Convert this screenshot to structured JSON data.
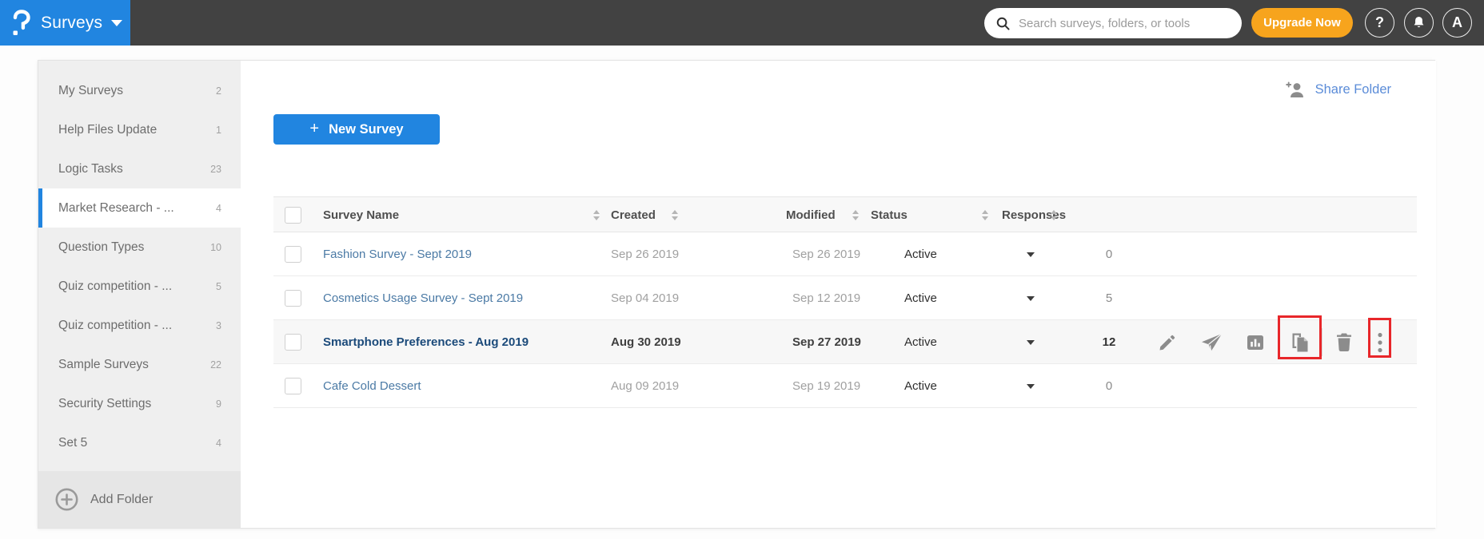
{
  "header": {
    "product_name": "Surveys",
    "search_placeholder": "Search surveys, folders, or tools",
    "upgrade_button": "Upgrade Now",
    "help_glyph": "?",
    "avatar_letter": "A"
  },
  "colors": {
    "topbar": "#424242",
    "brand_blue": "#2185e0",
    "accent_orange": "#f7a41d",
    "annotation_red": "#e8262a",
    "link_blue": "#4b7aa5"
  },
  "sidebar": {
    "items": [
      {
        "label": "My Surveys",
        "count": "2",
        "selected": false
      },
      {
        "label": "Help Files Update",
        "count": "1",
        "selected": false
      },
      {
        "label": "Logic Tasks",
        "count": "23",
        "selected": false
      },
      {
        "label": "Market Research - ...",
        "count": "4",
        "selected": true
      },
      {
        "label": "Question Types",
        "count": "10",
        "selected": false
      },
      {
        "label": "Quiz competition - ...",
        "count": "5",
        "selected": false
      },
      {
        "label": "Quiz competition - ...",
        "count": "3",
        "selected": false
      },
      {
        "label": "Sample Surveys",
        "count": "22",
        "selected": false
      },
      {
        "label": "Security Settings",
        "count": "9",
        "selected": false
      },
      {
        "label": "Set 5",
        "count": "4",
        "selected": false
      }
    ],
    "add_folder_label": "Add Folder"
  },
  "main": {
    "share_folder_label": "Share Folder",
    "new_survey_plus": "+",
    "new_survey_label": "New Survey",
    "table": {
      "columns": [
        "Survey Name",
        "Created",
        "Modified",
        "Status",
        "Responses"
      ],
      "rows": [
        {
          "name": "Fashion Survey - Sept 2019",
          "created": "Sep 26 2019",
          "modified": "Sep 26 2019",
          "status": "Active",
          "responses": "0",
          "highlighted": false
        },
        {
          "name": "Cosmetics Usage Survey - Sept 2019",
          "created": "Sep 04 2019",
          "modified": "Sep 12 2019",
          "status": "Active",
          "responses": "5",
          "highlighted": false
        },
        {
          "name": "Smartphone Preferences - Aug 2019",
          "created": "Aug 30 2019",
          "modified": "Sep 27 2019",
          "status": "Active",
          "responses": "12",
          "highlighted": true
        },
        {
          "name": "Cafe Cold Dessert",
          "created": "Aug 09 2019",
          "modified": "Sep 19 2019",
          "status": "Active",
          "responses": "0",
          "highlighted": false
        }
      ],
      "row_actions": [
        "edit",
        "send",
        "reports",
        "copy",
        "delete",
        "more"
      ],
      "annotated_actions": [
        "copy",
        "more"
      ]
    }
  }
}
